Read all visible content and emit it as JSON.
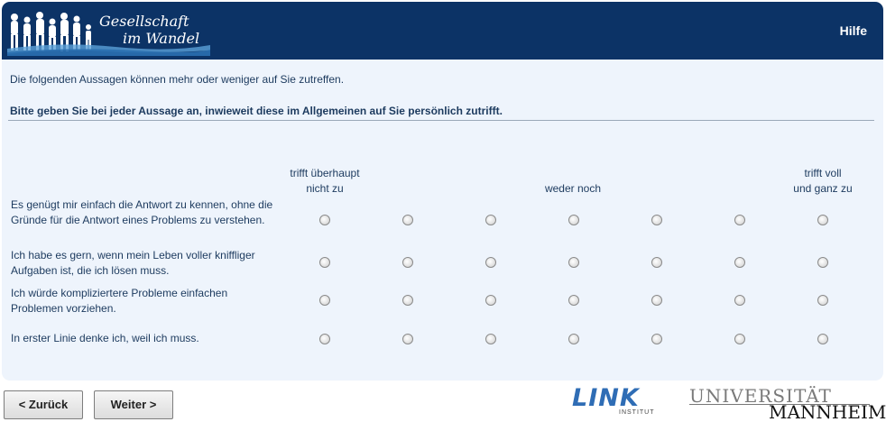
{
  "header": {
    "logo_line1": "Gesellschaft",
    "logo_line2": "im Wandel",
    "help_label": "Hilfe"
  },
  "intro_text": "Die folgenden Aussagen können mehr oder weniger auf Sie zutreffen.",
  "instruction_text": "Bitte geben Sie bei jeder Aussage an, inwieweit diese im Allgemeinen auf Sie persönlich zutrifft.",
  "scale": {
    "low_line1": "trifft überhaupt",
    "low_line2": "nicht zu",
    "mid": "weder noch",
    "high_line1": "trifft voll",
    "high_line2": "und ganz zu",
    "points": 7
  },
  "questions": [
    {
      "text": "Es genügt mir einfach die Antwort zu kennen, ohne die Gründe für die Antwort eines Problems zu verstehen.",
      "selected": null
    },
    {
      "text": "Ich habe es gern, wenn mein Leben voller kniffliger Aufgaben ist, die ich lösen muss.",
      "selected": null
    },
    {
      "text": "Ich würde kompliziertere Probleme einfachen Problemen vorziehen.",
      "selected": null
    },
    {
      "text": "In erster Linie denke ich, weil ich muss.",
      "selected": null
    }
  ],
  "nav": {
    "back_label": "< Zurück",
    "next_label": "Weiter >"
  },
  "logos": {
    "link_word": "LINK",
    "link_sub": "INSTITUT",
    "uni_top": "UNIVERSITÄT",
    "uni_bottom": "MANNHEIM"
  },
  "colors": {
    "header_bg": "#0c3366",
    "panel_bg": "#eef4fc",
    "text": "#1c3a5e",
    "link_blue": "#2f6db5"
  }
}
